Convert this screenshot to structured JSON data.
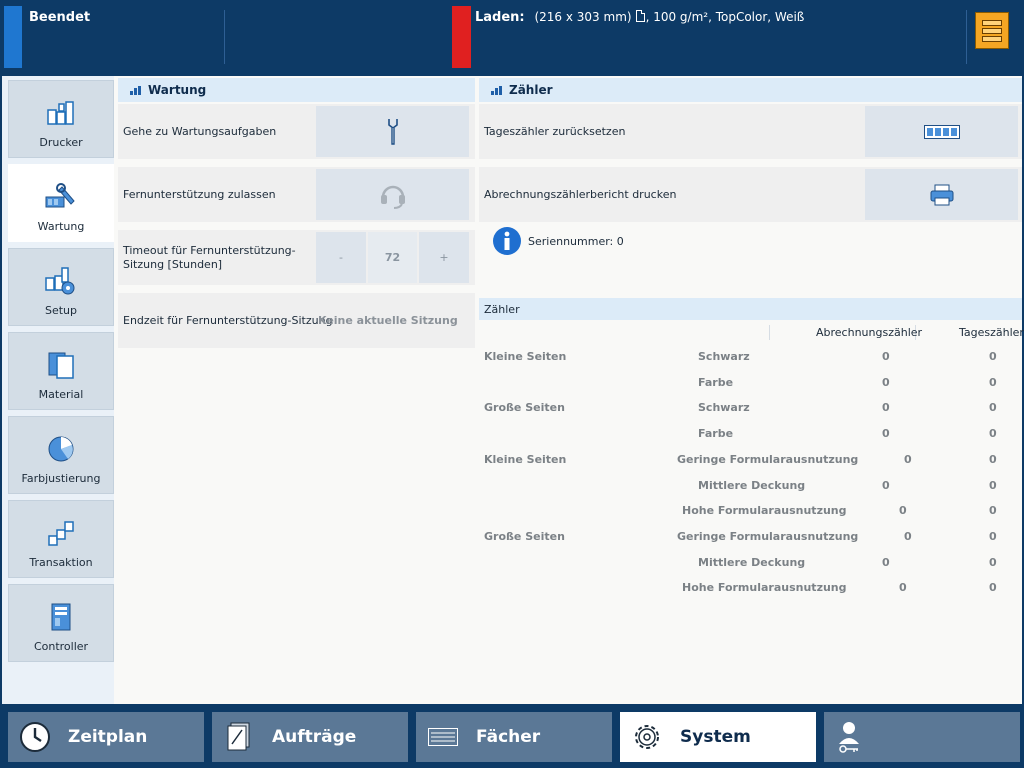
{
  "topbar": {
    "status": "Beendet",
    "load_label": "Laden:",
    "load_size": "(216 x 303 mm)",
    "load_media": ", 100 g/m², TopColor, Weiß",
    "colors": {
      "status": "#1f77d0",
      "alert": "#e02020",
      "tray": "#f5a623"
    }
  },
  "nav": {
    "items": [
      {
        "label": "Drucker",
        "icon": "printer-icon"
      },
      {
        "label": "Wartung",
        "icon": "maintenance-icon"
      },
      {
        "label": "Setup",
        "icon": "setup-icon"
      },
      {
        "label": "Material",
        "icon": "material-icon"
      },
      {
        "label": "Farbjustierung",
        "icon": "color-adjustment-icon"
      },
      {
        "label": "Transaktion",
        "icon": "transaction-icon"
      },
      {
        "label": "Controller",
        "icon": "controller-icon"
      }
    ],
    "active": "Wartung"
  },
  "wartung": {
    "title": "Wartung",
    "goto_label": "Gehe zu Wartungsaufgaben",
    "remote_label": "Fernunterstützung zulassen",
    "timeout_label": "Timeout für Fernunterstützung-Sitzung [Stunden]",
    "timeout_minus": "-",
    "timeout_value": "72",
    "timeout_plus": "+",
    "endtime_label": "Endzeit für Fernunterstützung-Sitzung",
    "endtime_value": "Keine aktuelle Sitzung"
  },
  "zaehler": {
    "title": "Zähler",
    "reset_label": "Tageszähler zurücksetzen",
    "report_label": "Abrechnungszählerbericht drucken",
    "serial": "Seriennummer: 0",
    "table_title": "Zähler",
    "col_billing": "Abrechnungszähler",
    "col_daily": "Tageszähler",
    "rows": [
      {
        "group": "Kleine Seiten",
        "type": "Schwarz",
        "billing": "0",
        "daily": "0"
      },
      {
        "group": "",
        "type": "Farbe",
        "billing": "0",
        "daily": "0"
      },
      {
        "group": "Große Seiten",
        "type": "Schwarz",
        "billing": "0",
        "daily": "0"
      },
      {
        "group": "",
        "type": "Farbe",
        "billing": "0",
        "daily": "0"
      },
      {
        "group": "Kleine Seiten",
        "type": "Geringe Formularausnutzung",
        "billing": "0",
        "daily": "0"
      },
      {
        "group": "",
        "type": "Mittlere Deckung",
        "billing": "0",
        "daily": "0"
      },
      {
        "group": "",
        "type": "Hohe Formularausnutzung",
        "billing": "0",
        "daily": "0"
      },
      {
        "group": "Große Seiten",
        "type": "Geringe Formularausnutzung",
        "billing": "0",
        "daily": "0"
      },
      {
        "group": "",
        "type": "Mittlere Deckung",
        "billing": "0",
        "daily": "0"
      },
      {
        "group": "",
        "type": "Hohe Formularausnutzung",
        "billing": "0",
        "daily": "0"
      }
    ]
  },
  "tabs": [
    {
      "label": "Zeitplan",
      "icon": "clock-icon"
    },
    {
      "label": "Aufträge",
      "icon": "jobs-icon"
    },
    {
      "label": "Fächer",
      "icon": "trays-icon"
    },
    {
      "label": "System",
      "icon": "gear-icon"
    },
    {
      "label": "",
      "icon": "user-key-icon"
    }
  ],
  "active_tab": "System"
}
